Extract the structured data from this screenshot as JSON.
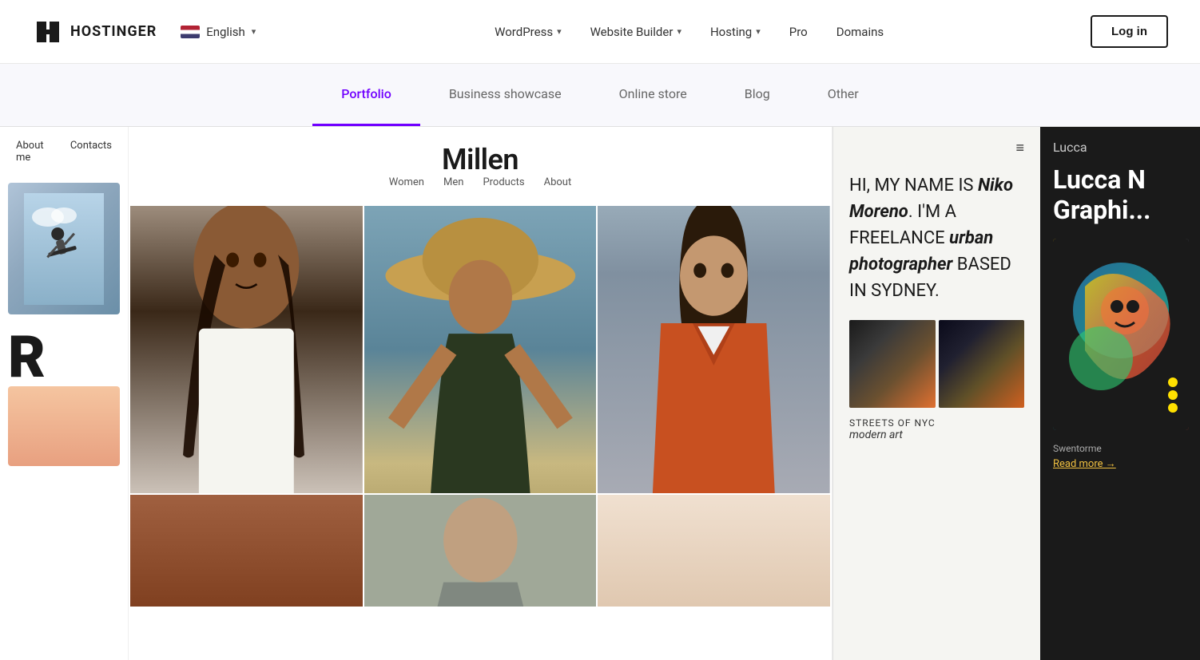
{
  "header": {
    "logo_text": "HOSTINGER",
    "lang_label": "English",
    "nav_items": [
      {
        "label": "WordPress",
        "has_dropdown": true
      },
      {
        "label": "Website Builder",
        "has_dropdown": true
      },
      {
        "label": "Hosting",
        "has_dropdown": true
      },
      {
        "label": "Pro",
        "has_dropdown": false
      },
      {
        "label": "Domains",
        "has_dropdown": false
      }
    ],
    "login_label": "Log in"
  },
  "tabs": {
    "items": [
      {
        "label": "Portfolio",
        "active": true
      },
      {
        "label": "Business showcase",
        "active": false
      },
      {
        "label": "Online store",
        "active": false
      },
      {
        "label": "Blog",
        "active": false
      },
      {
        "label": "Other",
        "active": false
      }
    ]
  },
  "left_panel": {
    "nav_items": [
      "About me",
      "Contacts"
    ],
    "big_letter": "R"
  },
  "millen": {
    "title": "Millen",
    "nav_items": [
      "Women",
      "Men",
      "Products",
      "About"
    ]
  },
  "right_panel": {
    "bio_line1": "HI, MY NAME IS ",
    "bio_name": "Niko Moreno",
    "bio_line2": ". I'M A FREELANCE ",
    "bio_specialty": "urban photographer",
    "bio_line3": " BASED IN SYDNEY.",
    "streets_title": "STREETS OF NYC",
    "streets_sub": "modern art"
  },
  "lucca_panel": {
    "title_small": "Lucca",
    "title_big": "Lucca N Graphi...",
    "swentorme": "Swentorme",
    "read_more": "Read more →"
  }
}
